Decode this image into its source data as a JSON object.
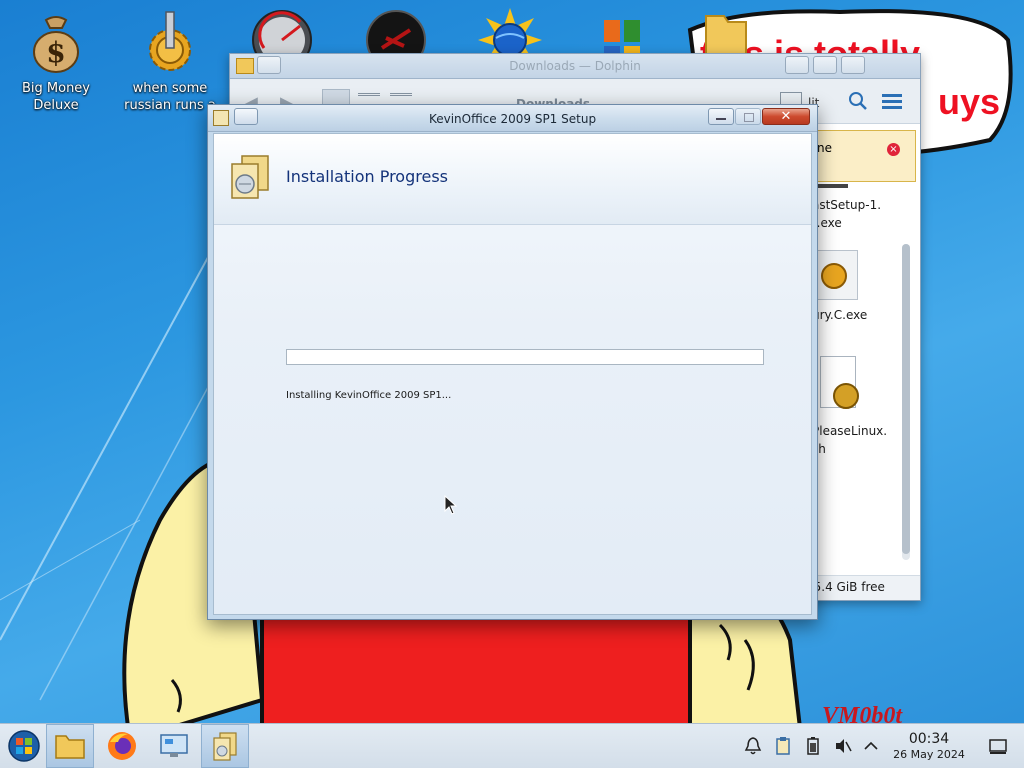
{
  "desktop": {
    "icons": [
      {
        "label": "Big Money Deluxe",
        "icon": "money-bag-icon"
      },
      {
        "label": "when some russian runs a",
        "icon": "gear-icon"
      },
      {
        "label": "",
        "icon": "gauge-icon"
      },
      {
        "label": "",
        "icon": "dark-orb-icon"
      },
      {
        "label": "",
        "icon": "sun-globe-icon"
      },
      {
        "label": "",
        "icon": "office-logo-icon"
      },
      {
        "label": "",
        "icon": "folder-icon"
      }
    ],
    "wallpaper_caption_line1": "this is totally",
    "wallpaper_caption_line2": "uys",
    "wallpaper_signature": "VM0b0t"
  },
  "dolphin": {
    "title": "Downloads — Dolphin",
    "breadcrumb": "Downloads",
    "split_label": "lit",
    "notification_text": "ne",
    "files": [
      {
        "name_line1": "astSetup-1.",
        "name_line2": ").exe"
      },
      {
        "name_line1": "ury.C.exe",
        "name_line2": ""
      },
      {
        "name_line1": "PleaseLinux.",
        "name_line2": "sh"
      }
    ],
    "free_space": "75.4 GiB free"
  },
  "setup": {
    "title": "KevinOffice 2009 SP1 Setup",
    "heading": "Installation Progress",
    "status": "Installing KevinOffice 2009 SP1...",
    "progress_fraction": 0
  },
  "taskbar": {
    "time": "00:34",
    "date": "26 May 2024",
    "apps": [
      "start-orb-icon",
      "file-manager-icon",
      "firefox-icon",
      "control-panel-icon",
      "installer-icon"
    ],
    "tray": [
      "notifications-icon",
      "clipboard-icon",
      "battery-icon",
      "volume-muted-icon",
      "tray-expand-icon",
      "show-desktop-icon"
    ]
  },
  "colors": {
    "wallpaper_blue": "#2c97e0",
    "caption_red": "#ee1122",
    "heading_blue": "#14337a",
    "close_red": "#cd4a2e"
  }
}
